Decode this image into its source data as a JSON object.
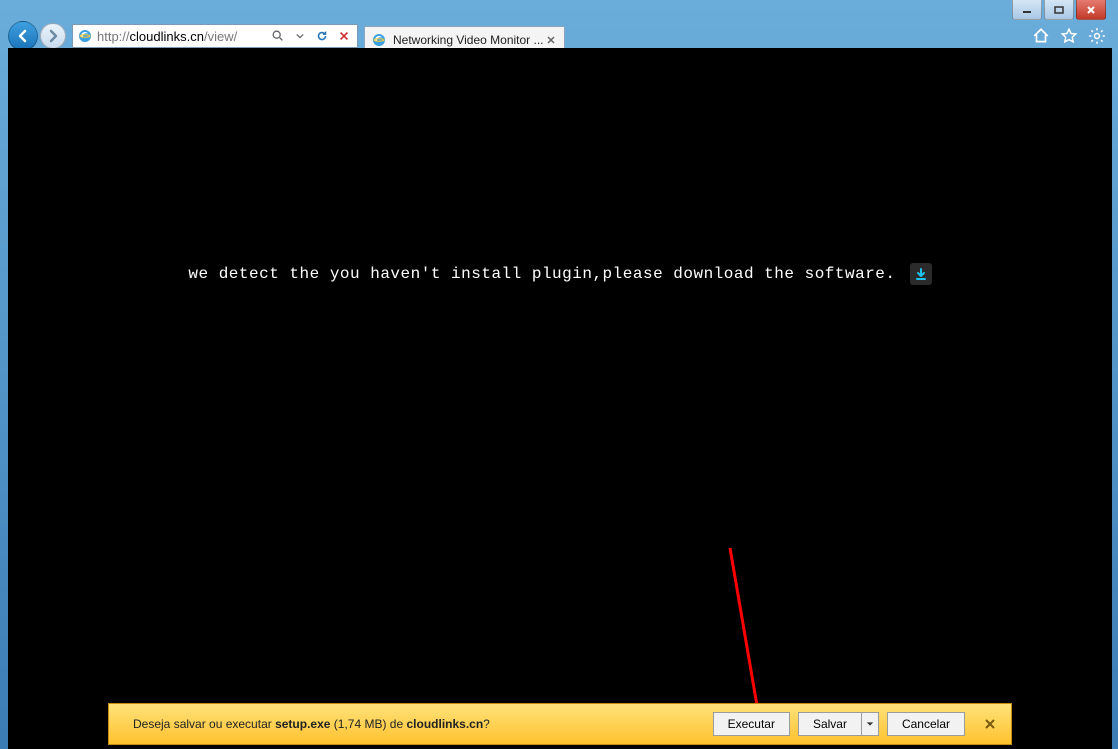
{
  "address": {
    "prefix": "http://",
    "host": "cloudlinks.cn",
    "path": "/view/"
  },
  "tab": {
    "title": "Networking Video Monitor ..."
  },
  "page": {
    "plugin_message": "we detect the you haven't install plugin,please download the software."
  },
  "download_bar": {
    "prompt_prefix": "Deseja salvar ou executar ",
    "filename": "setup.exe",
    "size": "(1,74 MB)",
    "from_word": " de ",
    "source": "cloudlinks.cn",
    "suffix": "?",
    "execute": "Executar",
    "save": "Salvar",
    "cancel": "Cancelar"
  }
}
